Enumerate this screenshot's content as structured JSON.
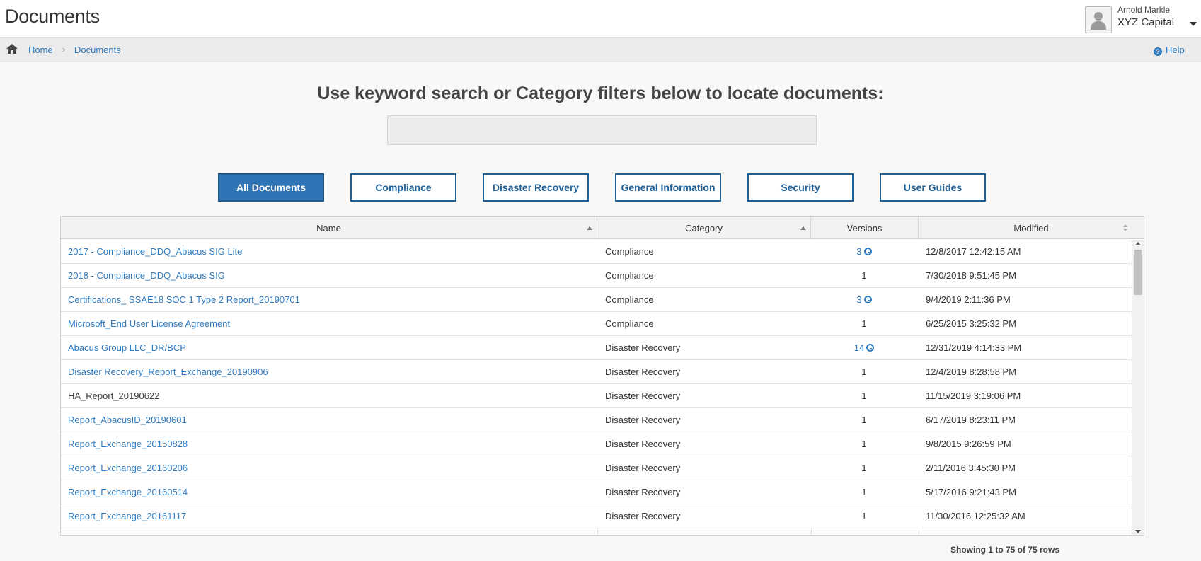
{
  "header": {
    "title": "Documents",
    "user_name": "Arnold Markle",
    "user_org": "XYZ Capital"
  },
  "breadcrumb": {
    "home": "Home",
    "separator": "›",
    "current": "Documents",
    "help": "Help"
  },
  "search": {
    "heading": "Use keyword search or Category filters below to locate documents:",
    "value": "",
    "placeholder": ""
  },
  "filters": [
    {
      "label": "All Documents",
      "active": true
    },
    {
      "label": "Compliance",
      "active": false
    },
    {
      "label": "Disaster Recovery",
      "active": false
    },
    {
      "label": "General Information",
      "active": false
    },
    {
      "label": "Security",
      "active": false
    },
    {
      "label": "User Guides",
      "active": false
    }
  ],
  "table": {
    "columns": [
      "Name",
      "Category",
      "Versions",
      "Modified"
    ],
    "rows": [
      {
        "name": "2017 - Compliance_DDQ_Abacus SIG Lite",
        "category": "Compliance",
        "versions": "3",
        "has_history": true,
        "modified": "12/8/2017 12:42:15 AM",
        "linked": true
      },
      {
        "name": "2018 - Compliance_DDQ_Abacus SIG",
        "category": "Compliance",
        "versions": "1",
        "has_history": false,
        "modified": "7/30/2018 9:51:45 PM",
        "linked": true
      },
      {
        "name": "Certifications_ SSAE18 SOC 1 Type 2 Report_20190701",
        "category": "Compliance",
        "versions": "3",
        "has_history": true,
        "modified": "9/4/2019 2:11:36 PM",
        "linked": true
      },
      {
        "name": "Microsoft_End User License Agreement",
        "category": "Compliance",
        "versions": "1",
        "has_history": false,
        "modified": "6/25/2015 3:25:32 PM",
        "linked": true
      },
      {
        "name": "Abacus Group LLC_DR/BCP",
        "category": "Disaster Recovery",
        "versions": "14",
        "has_history": true,
        "modified": "12/31/2019 4:14:33 PM",
        "linked": true
      },
      {
        "name": "Disaster Recovery_Report_Exchange_20190906",
        "category": "Disaster Recovery",
        "versions": "1",
        "has_history": false,
        "modified": "12/4/2019 8:28:58 PM",
        "linked": true
      },
      {
        "name": "HA_Report_20190622",
        "category": "Disaster Recovery",
        "versions": "1",
        "has_history": false,
        "modified": "11/15/2019 3:19:06 PM",
        "linked": false
      },
      {
        "name": "Report_AbacusID_20190601",
        "category": "Disaster Recovery",
        "versions": "1",
        "has_history": false,
        "modified": "6/17/2019 8:23:11 PM",
        "linked": true
      },
      {
        "name": "Report_Exchange_20150828",
        "category": "Disaster Recovery",
        "versions": "1",
        "has_history": false,
        "modified": "9/8/2015 9:26:59 PM",
        "linked": true
      },
      {
        "name": "Report_Exchange_20160206",
        "category": "Disaster Recovery",
        "versions": "1",
        "has_history": false,
        "modified": "2/11/2016 3:45:30 PM",
        "linked": true
      },
      {
        "name": "Report_Exchange_20160514",
        "category": "Disaster Recovery",
        "versions": "1",
        "has_history": false,
        "modified": "5/17/2016 9:21:43 PM",
        "linked": true
      },
      {
        "name": "Report_Exchange_20161117",
        "category": "Disaster Recovery",
        "versions": "1",
        "has_history": false,
        "modified": "11/30/2016 12:25:32 AM",
        "linked": true
      }
    ],
    "footer": "Showing 1 to 75 of 75 rows"
  },
  "colors": {
    "link": "#2f7bbf",
    "active_button": "#2f74b5",
    "button_border": "#1f5f94"
  }
}
